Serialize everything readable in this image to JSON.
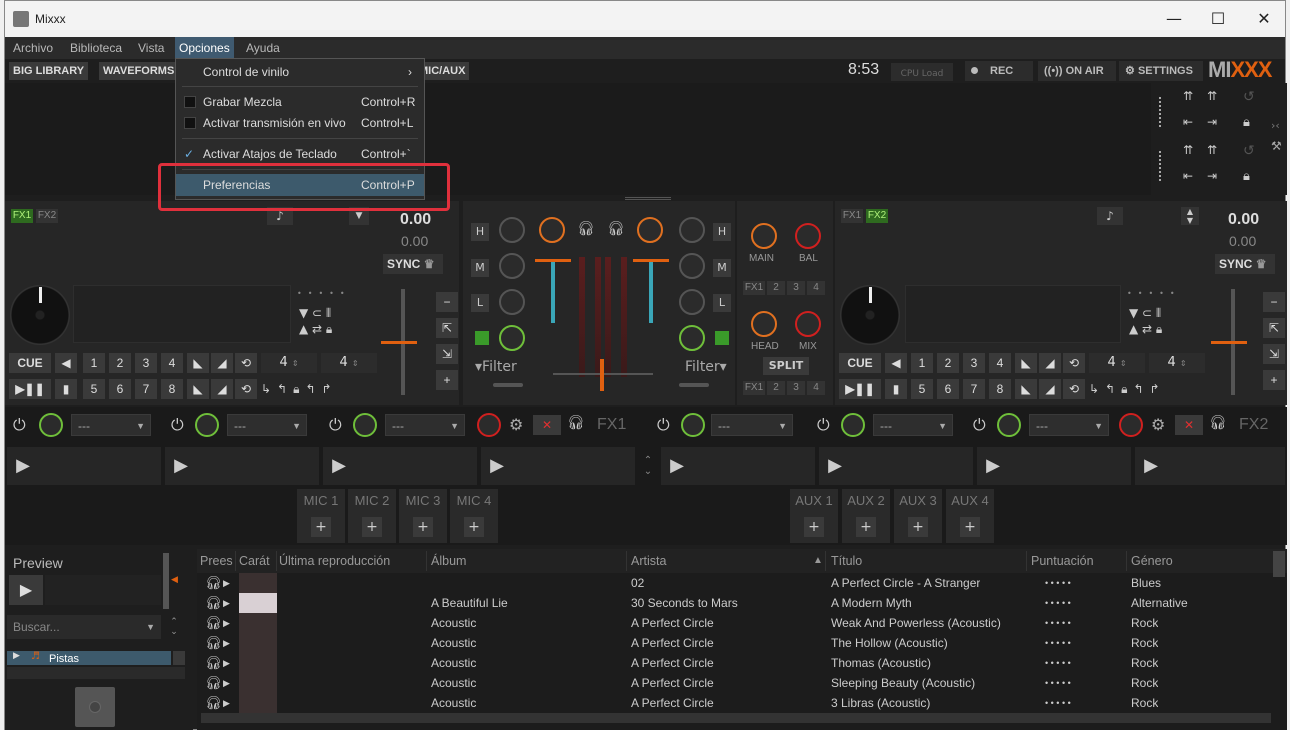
{
  "window": {
    "title": "Mixxx",
    "controls": {
      "minimize": "—",
      "maximize": "☐",
      "close": "✕"
    }
  },
  "menubar": [
    "Archivo",
    "Biblioteca",
    "Vista",
    "Opciones",
    "Ayuda"
  ],
  "toolbar": {
    "left_buttons": [
      "BIG LIBRARY",
      "WAVEFORMS",
      "MIC/AUX"
    ],
    "clock": "8:53",
    "cpu_label": "CPU Load",
    "rec": "REC",
    "on_air": "ON AIR",
    "settings": "SETTINGS",
    "logo": "MIXXX"
  },
  "options_menu": {
    "items": [
      {
        "label": "Control de vinilo",
        "shortcut": "",
        "submenu": true
      },
      {
        "label": "Grabar Mezcla",
        "shortcut": "Control+R",
        "checked": false
      },
      {
        "label": "Activar transmisión en vivo",
        "shortcut": "Control+L",
        "checked": false
      },
      {
        "label": "Activar Atajos de Teclado",
        "shortcut": "Control+`",
        "checked": true
      },
      {
        "label": "Preferencias",
        "shortcut": "Control+P",
        "selected": true
      }
    ]
  },
  "deck1": {
    "fx": [
      "FX1",
      "FX2"
    ],
    "bpm": "0.00",
    "rate": "0.00",
    "sync": "SYNC",
    "cue": "CUE",
    "hotcues_top": [
      "1",
      "2",
      "3",
      "4"
    ],
    "hotcues_bottom": [
      "5",
      "6",
      "7",
      "8"
    ],
    "beatjump": "4",
    "loop": "4"
  },
  "deck2": {
    "fx": [
      "FX1",
      "FX2"
    ],
    "bpm": "0.00",
    "rate": "0.00",
    "sync": "SYNC",
    "cue": "CUE",
    "hotcues_top": [
      "1",
      "2",
      "3",
      "4"
    ],
    "hotcues_bottom": [
      "5",
      "6",
      "7",
      "8"
    ],
    "beatjump": "4",
    "loop": "4"
  },
  "mixer": {
    "eq": [
      "H",
      "M",
      "L"
    ],
    "filter": "Filter",
    "main": "MAIN",
    "bal": "BAL",
    "head": "HEAD",
    "mix": "MIX",
    "split": "SPLIT",
    "fx_assign": [
      "FX1",
      "2",
      "3",
      "4"
    ]
  },
  "fx_rack": {
    "unit1": "FX1",
    "unit2": "FX2",
    "effect_value": "---"
  },
  "mic_aux": {
    "mics": [
      "MIC 1",
      "MIC 2",
      "MIC 3",
      "MIC 4"
    ],
    "auxes": [
      "AUX 1",
      "AUX 2",
      "AUX 3",
      "AUX 4"
    ],
    "add": "+"
  },
  "library_sidebar": {
    "preview": "Preview",
    "search_placeholder": "Buscar...",
    "tree_item": "Pistas"
  },
  "library": {
    "columns": [
      "Prees",
      "Carát",
      "Última reproducción",
      "Álbum",
      "Artista",
      "Título",
      "Puntuación",
      "Género"
    ],
    "rating": "• • • • •",
    "rows": [
      {
        "album": "",
        "artist": "02",
        "title": "A Perfect Circle - A Stranger",
        "genre": "Blues"
      },
      {
        "album": "A Beautiful Lie",
        "artist": "30 Seconds to Mars",
        "title": "A Modern Myth",
        "genre": "Alternative"
      },
      {
        "album": "Acoustic",
        "artist": "A Perfect Circle",
        "title": "Weak And Powerless (Acoustic)",
        "genre": "Rock"
      },
      {
        "album": "Acoustic",
        "artist": "A Perfect Circle",
        "title": "The Hollow (Acoustic)",
        "genre": "Rock"
      },
      {
        "album": "Acoustic",
        "artist": "A Perfect Circle",
        "title": "Thomas (Acoustic)",
        "genre": "Rock"
      },
      {
        "album": "Acoustic",
        "artist": "A Perfect Circle",
        "title": "Sleeping Beauty (Acoustic)",
        "genre": "Rock"
      },
      {
        "album": "Acoustic",
        "artist": "A Perfect Circle",
        "title": "3 Libras (Acoustic)",
        "genre": "Rock"
      }
    ]
  },
  "colors": {
    "accent": "#e06010",
    "highlight": "#e0303c",
    "menu_selected": "#3d5a6c",
    "fx_on": "#2e6a1f"
  }
}
